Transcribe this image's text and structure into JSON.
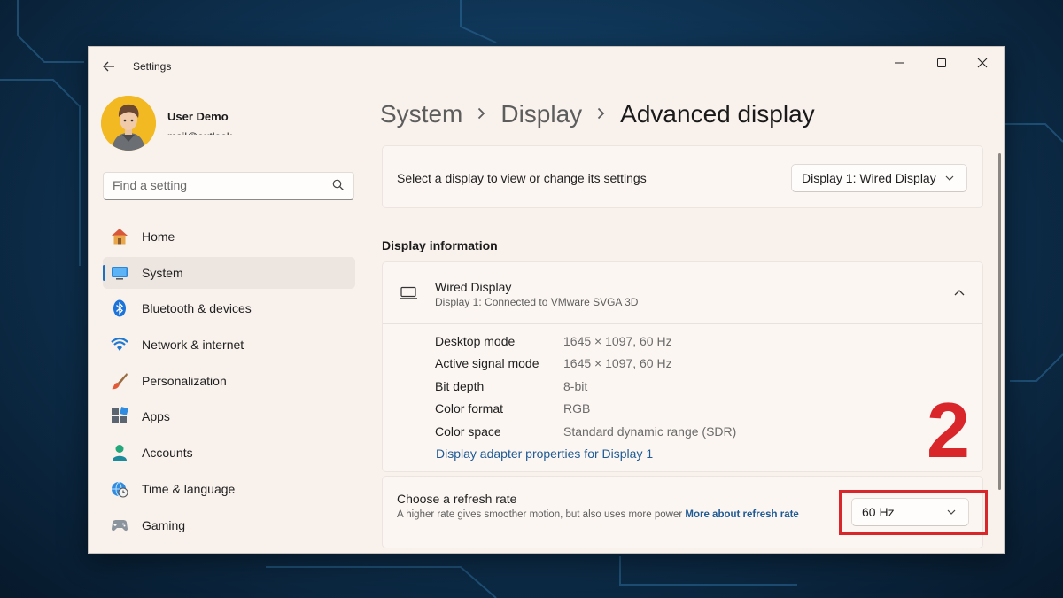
{
  "window": {
    "title": "Settings"
  },
  "user": {
    "name": "User Demo",
    "email": "mail@outlook"
  },
  "search": {
    "placeholder": "Find a setting"
  },
  "nav": {
    "items": [
      {
        "label": "Home",
        "icon": "home-icon",
        "active": false
      },
      {
        "label": "System",
        "icon": "system-icon",
        "active": true
      },
      {
        "label": "Bluetooth & devices",
        "icon": "bluetooth-icon",
        "active": false
      },
      {
        "label": "Network & internet",
        "icon": "wifi-icon",
        "active": false
      },
      {
        "label": "Personalization",
        "icon": "brush-icon",
        "active": false
      },
      {
        "label": "Apps",
        "icon": "apps-icon",
        "active": false
      },
      {
        "label": "Accounts",
        "icon": "accounts-icon",
        "active": false
      },
      {
        "label": "Time & language",
        "icon": "globe-clock-icon",
        "active": false
      },
      {
        "label": "Gaming",
        "icon": "gamepad-icon",
        "active": false
      }
    ]
  },
  "breadcrumb": {
    "items": [
      "System",
      "Display"
    ],
    "current": "Advanced display"
  },
  "display_select": {
    "label": "Select a display to view or change its settings",
    "value": "Display 1: Wired Display"
  },
  "display_info": {
    "section_title": "Display information",
    "name": "Wired Display",
    "subtitle": "Display 1: Connected to VMware SVGA 3D",
    "rows": [
      {
        "label": "Desktop mode",
        "value": "1645 × 1097, 60 Hz"
      },
      {
        "label": "Active signal mode",
        "value": "1645 × 1097, 60 Hz"
      },
      {
        "label": "Bit depth",
        "value": "8-bit"
      },
      {
        "label": "Color format",
        "value": "RGB"
      },
      {
        "label": "Color space",
        "value": "Standard dynamic range (SDR)"
      }
    ],
    "adapter_link": "Display adapter properties for Display 1"
  },
  "refresh": {
    "title": "Choose a refresh rate",
    "description": "A higher rate gives smoother motion, but also uses more power",
    "link": "More about refresh rate",
    "value": "60 Hz"
  },
  "annotation": {
    "step": "2",
    "color": "#d9262b"
  },
  "colors": {
    "accent": "#1f6fbf",
    "link": "#1f5a94",
    "window_bg": "#f8f1ec"
  }
}
